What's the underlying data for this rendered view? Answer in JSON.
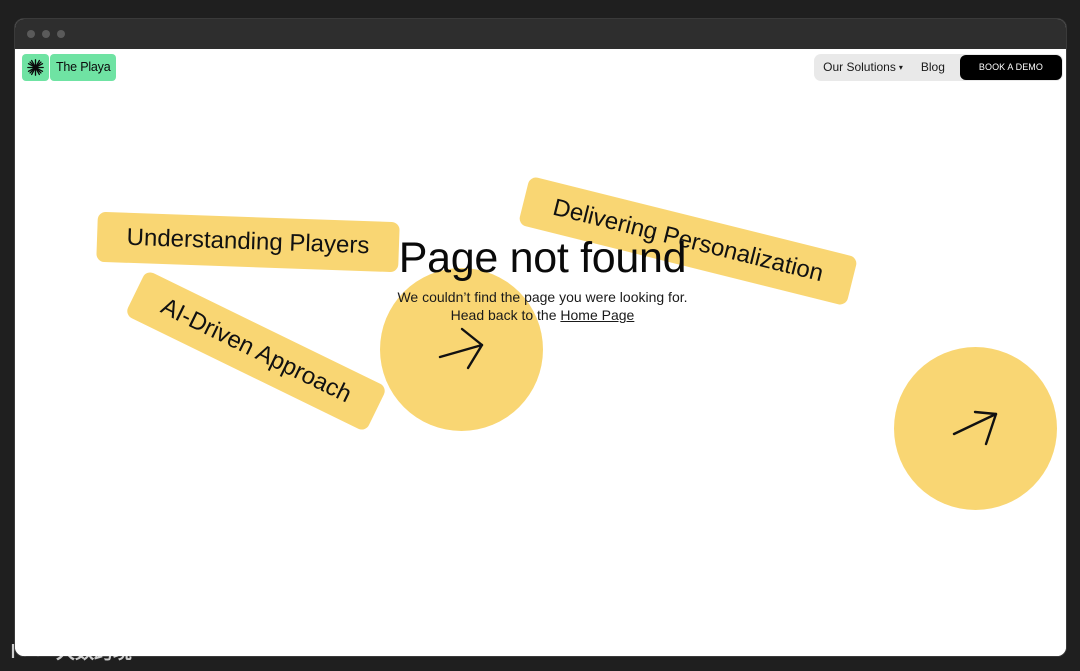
{
  "brand": {
    "name": "The Playa",
    "accent": "#6fe3a3"
  },
  "nav": {
    "solutions_label": "Our Solutions",
    "solutions_caret": "▾",
    "blog_label": "Blog",
    "demo_label": "BOOK A DEMO"
  },
  "pills": {
    "understanding": "Understanding Players",
    "delivering": "Delivering Personalization",
    "ai": "AI-Driven Approach"
  },
  "error": {
    "title": "Page not found",
    "message": "We couldn’t find the page you were looking for.",
    "back_prefix": "Head back to the",
    "home_link": "Home Page"
  },
  "colors": {
    "pill_yellow": "#f9d673",
    "button_black": "#000000"
  },
  "icons": {
    "logo": "starburst-icon",
    "arrow": "arrow-up-right-icon"
  },
  "watermark": {
    "text": "大数跨境"
  }
}
